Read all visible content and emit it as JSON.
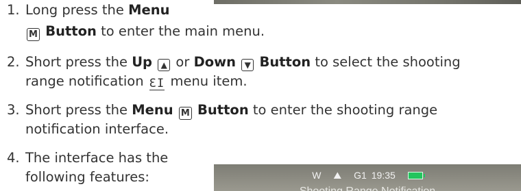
{
  "steps": [
    {
      "number": "1.",
      "line1": {
        "t1": "Long press the ",
        "b1": "Menu"
      },
      "line2": {
        "key": "M",
        "b1": "Button",
        "t1": " to enter the main menu."
      }
    },
    {
      "number": "2.",
      "line1": {
        "t1": "Short press the ",
        "b1": "Up",
        "key1": "▲",
        "t2": " or ",
        "b2": "Down",
        "key2": "▼",
        "b3": "Button",
        "t3": " to select the shooting"
      },
      "line2": {
        "t1": "range notification ",
        "icon": "ƐI",
        "t2": " menu item."
      }
    },
    {
      "number": "3.",
      "line1": {
        "t1": "Short press the ",
        "b1": "Menu",
        "key": "M",
        "b2": "Button",
        "t2": " to enter the shooting range"
      },
      "line2": {
        "t1": "notification interface."
      }
    },
    {
      "number": "4.",
      "line1": {
        "t1": "The interface has the"
      },
      "line2": {
        "t1": "following features:"
      }
    }
  ],
  "device_screen": {
    "status": {
      "wind": "W",
      "mode_icon": "⛰",
      "profile": "G1",
      "time": "19:35"
    },
    "battery_color": "#22c55e",
    "title": "Shooting Range Notification"
  }
}
